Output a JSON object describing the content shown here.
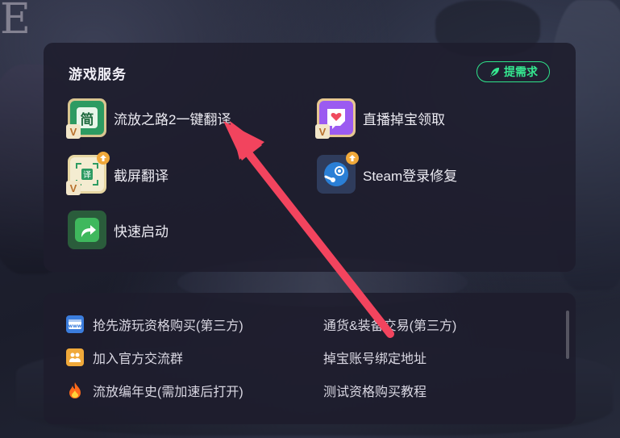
{
  "background": {
    "logo_fragment": "E"
  },
  "services": {
    "title": "游戏服务",
    "request_button": "提需求",
    "items": [
      {
        "label": "流放之路2一键翻译",
        "icon": "translate-simplified-icon",
        "icon_text": "简",
        "badge": "V"
      },
      {
        "label": "直播掉宝领取",
        "icon": "twitch-drops-icon",
        "badge": "V"
      },
      {
        "label": "截屏翻译",
        "icon": "screenshot-translate-icon",
        "icon_text": "译",
        "badge": "V",
        "upgrade": true
      },
      {
        "label": "Steam登录修复",
        "icon": "steam-icon",
        "upgrade": true
      },
      {
        "label": "快速启动",
        "icon": "quick-launch-icon"
      }
    ]
  },
  "links": {
    "items": [
      {
        "label": "抢先游玩资格购买(第三方)",
        "icon": "www-icon"
      },
      {
        "label": "加入官方交流群",
        "icon": "group-icon"
      },
      {
        "label": "流放编年史(需加速后打开)",
        "icon": "fire-icon"
      },
      {
        "label": "通货&装备交易(第三方)"
      },
      {
        "label": "掉宝账号绑定地址"
      },
      {
        "label": "测试资格购买教程"
      }
    ]
  },
  "colors": {
    "accent_green": "#2ee38a",
    "annotation_arrow": "#f2445e",
    "panel_bg": "#1e1c2c"
  }
}
